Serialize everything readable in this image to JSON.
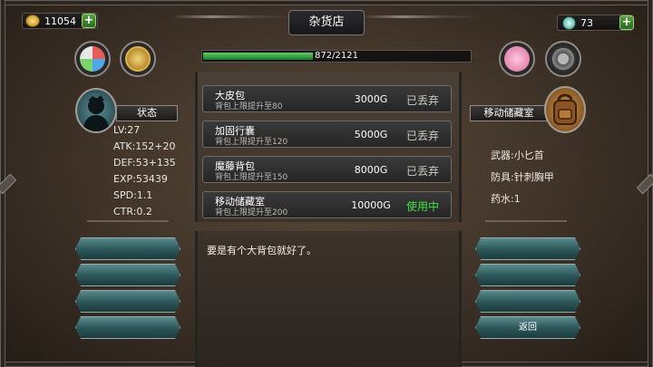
{
  "header": {
    "title": "杂货店",
    "gold": "11054",
    "gems": "73"
  },
  "exp": {
    "text": "872/2121",
    "progress": 0.41
  },
  "character": {
    "status_label": "状态",
    "stats": [
      "LV:27",
      "ATK:152+20",
      "DEF:53+135",
      "EXP:53439",
      "SPD:1.1",
      "CTR:0.2"
    ]
  },
  "shop": {
    "items": [
      {
        "name": "大皮包",
        "desc": "背包上限提升至80",
        "price": "3000G",
        "status": "已丢弃",
        "status_color": "#cfcac3"
      },
      {
        "name": "加固行囊",
        "desc": "背包上限提升至120",
        "price": "5000G",
        "status": "已丢弃",
        "status_color": "#cfcac3"
      },
      {
        "name": "魔藤背包",
        "desc": "背包上限提升至150",
        "price": "8000G",
        "status": "已丢弃",
        "status_color": "#cfcac3"
      },
      {
        "name": "移动储藏室",
        "desc": "背包上限提升至200",
        "price": "10000G",
        "status": "使用中",
        "status_color": "#3ee43e"
      }
    ]
  },
  "dialog": {
    "text": "要是有个大背包就好了。"
  },
  "storage": {
    "label": "移动储藏室",
    "weapon": "武器:小匕首",
    "armor": "防具:针刺胸甲",
    "potion": "药水:1"
  },
  "right_buttons": {
    "back": "返回"
  },
  "icons": {
    "gold": "coin-stack-icon",
    "gem": "gem-icon",
    "add": "plus-icon",
    "avatar": "hero-silhouette-icon",
    "bag": "backpack-icon"
  },
  "colors": {
    "exp_fill": "#3fb24a",
    "teal_button": "#2b5557",
    "in_use": "#3ee43e"
  }
}
